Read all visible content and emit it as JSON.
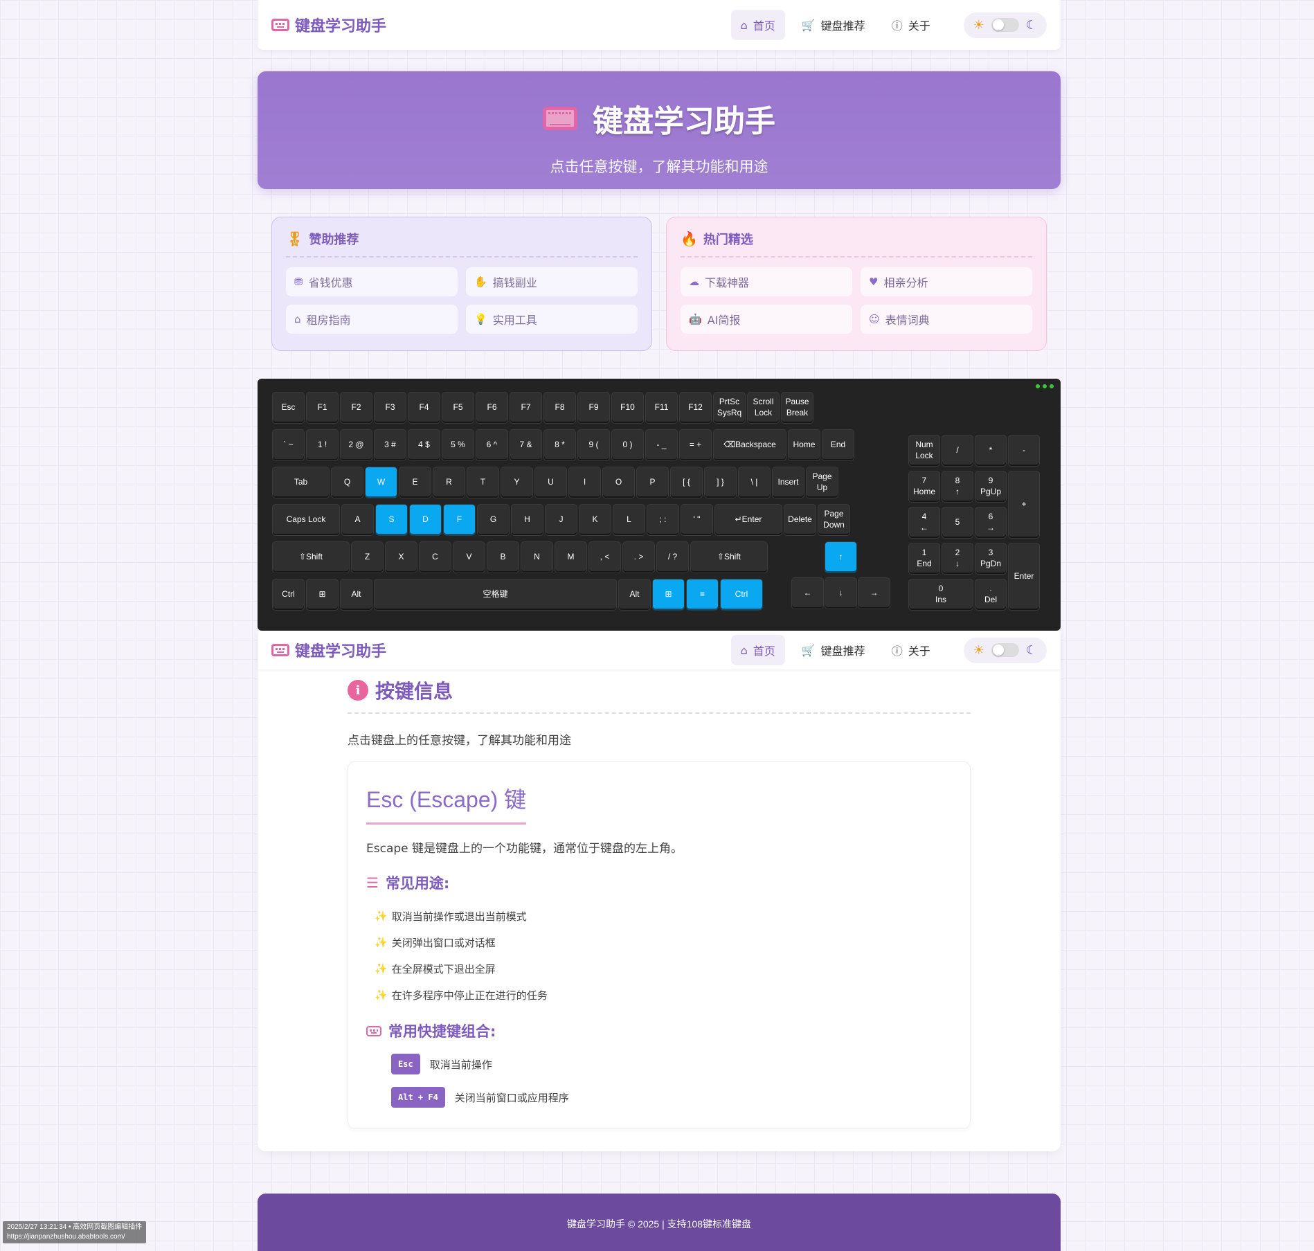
{
  "nav": {
    "brand": "键盘学习助手",
    "links": [
      {
        "label": "首页",
        "icon": "home-icon"
      },
      {
        "label": "键盘推荐",
        "icon": "cart-icon"
      },
      {
        "label": "关于",
        "icon": "info-icon"
      }
    ]
  },
  "hero": {
    "title": "键盘学习助手",
    "subtitle": "点击任意按键，了解其功能和用途"
  },
  "promo": {
    "left": {
      "title": "赞助推荐",
      "items": [
        "省钱优惠",
        "搞钱副业",
        "租房指南",
        "实用工具"
      ]
    },
    "right": {
      "title": "热门精选",
      "items": [
        "下载神器",
        "相亲分析",
        "AI简报",
        "表情词典"
      ]
    }
  },
  "keyboard": {
    "highlight_color": "#0aa8f0",
    "keys": [
      "Esc",
      "F1",
      "F2",
      "F3",
      "F4",
      "F5",
      "F6",
      "F7",
      "F8",
      "F9",
      "F10",
      "F11",
      "F12",
      "PrtSc\nSysRq",
      "Scroll\nLock",
      "Pause\nBreak",
      "` ~",
      "1 !",
      "2 @",
      "3 #",
      "4 $",
      "5 %",
      "6 ^",
      "7 &",
      "8 *",
      "9 (",
      "0 )",
      "- _",
      "= +",
      "⌫Backspace",
      "Home",
      "End",
      "Tab",
      "Q",
      "W",
      "E",
      "R",
      "T",
      "Y",
      "U",
      "I",
      "O",
      "P",
      "[ {",
      "] }",
      "\\ |",
      "Insert",
      "Page\nUp",
      "Caps Lock",
      "A",
      "S",
      "D",
      "F",
      "G",
      "H",
      "J",
      "K",
      "L",
      "; :",
      "' \"",
      "↵Enter",
      "Delete",
      "Page\nDown",
      "⇧Shift",
      "Z",
      "X",
      "C",
      "V",
      "B",
      "N",
      "M",
      ", <",
      ". >",
      "/ ?",
      "⇧Shift",
      "Ctrl",
      "⊞",
      "Alt",
      "空格键",
      "Alt",
      "⊞",
      "≡",
      "Ctrl",
      "↑",
      "←",
      "↓",
      "→",
      "Num\nLock",
      "/",
      "*",
      "-",
      "7\nHome",
      "8\n↑",
      "9\nPgUp",
      "+",
      "4\n←",
      "5",
      "6\n→",
      "1\nEnd",
      "2\n↓",
      "3\nPgDn",
      "Enter",
      "0\nIns",
      ".\nDel"
    ]
  },
  "info": {
    "title": "按键信息",
    "desc": "点击键盘上的任意按键，了解其功能和用途",
    "key_title": "Esc (Escape) 键",
    "key_desc": "Escape 键是键盘上的一个功能键，通常位于键盘的左上角。",
    "uses_title": "常见用途:",
    "uses": [
      "取消当前操作或退出当前模式",
      "关闭弹出窗口或对话框",
      "在全屏模式下退出全屏",
      "在许多程序中停止正在进行的任务"
    ],
    "shortcuts_title": "常用快捷键组合:",
    "shortcuts": [
      {
        "keys": "Esc",
        "desc": "取消当前操作"
      },
      {
        "keys": "Alt + F4",
        "desc": "关闭当前窗口或应用程序"
      }
    ]
  },
  "footer": {
    "text": "键盘学习助手 © 2025 | 支持108键标准键盘"
  },
  "stamp": {
    "line1": "2025/2/27 13:21:34 • 高效网页截图编辑插件",
    "line2": "https://jianpanzhushou.ababtools.com/"
  }
}
